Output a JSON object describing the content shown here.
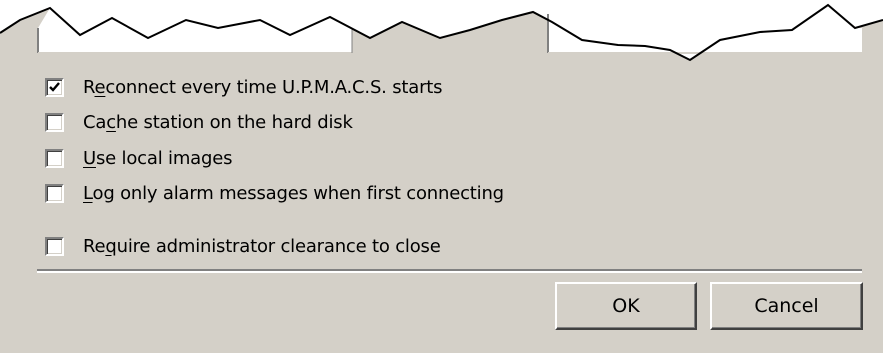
{
  "options": [
    {
      "before": "R",
      "accel": "e",
      "after": "connect every time U.P.M.A.C.S. starts",
      "checked": true
    },
    {
      "before": "Ca",
      "accel": "c",
      "after": "he station on the hard disk",
      "checked": false
    },
    {
      "before": "",
      "accel": "U",
      "after": "se local images",
      "checked": false
    },
    {
      "before": "",
      "accel": "L",
      "after": "og only alarm messages when first connecting",
      "checked": false
    },
    {
      "before": "Re",
      "accel": "q",
      "after": "uire administrator clearance to close",
      "checked": false
    }
  ],
  "buttons": {
    "ok_label": "OK",
    "cancel_label": "Cancel"
  },
  "colors": {
    "face": "#d4d0c8",
    "shadow": "#808080",
    "dark_shadow": "#404040",
    "highlight": "#ffffff",
    "torn_background": "#ffffff"
  }
}
